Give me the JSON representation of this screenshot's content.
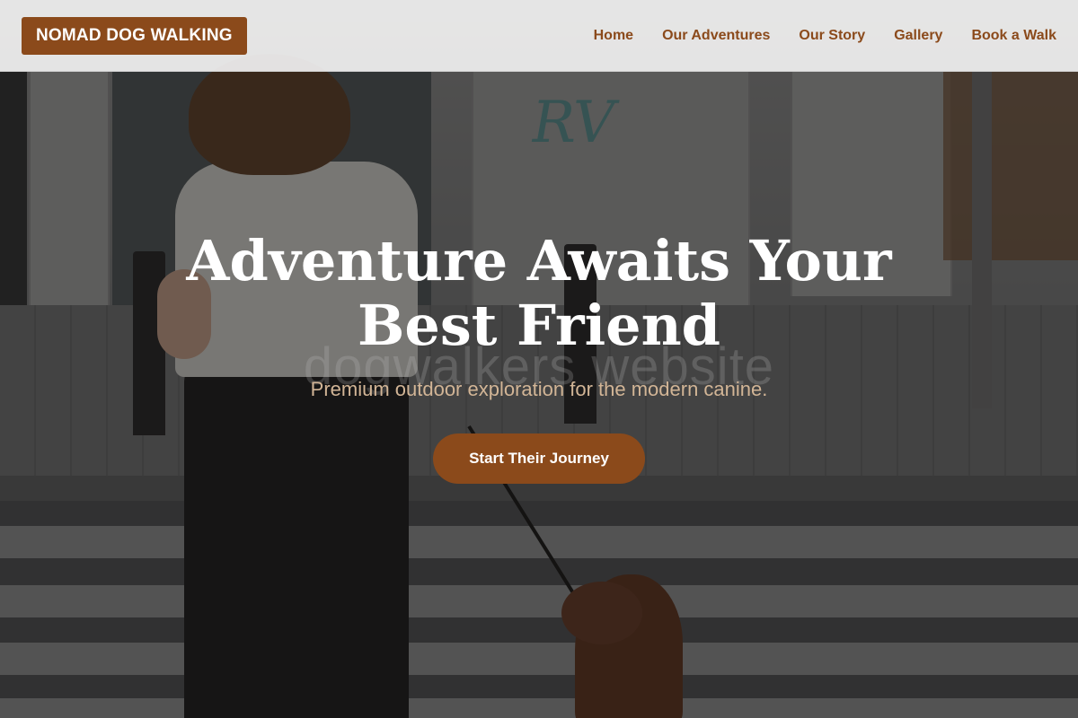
{
  "header": {
    "logo_text": "NOMAD DOG WALKING",
    "nav": [
      {
        "label": "Home"
      },
      {
        "label": "Our Adventures"
      },
      {
        "label": "Our Story"
      },
      {
        "label": "Gallery"
      },
      {
        "label": "Book a Walk"
      }
    ]
  },
  "hero": {
    "headline": "Adventure Awaits Your Best Friend",
    "watermark": "dogwalkers website",
    "subline": "Premium outdoor exploration for the modern canine.",
    "cta_label": "Start Their Journey",
    "graffiti_text": "RV"
  },
  "colors": {
    "accent": "#8b4a1b",
    "subline": "#d2b596",
    "header_bg": "#f0f0f0"
  }
}
